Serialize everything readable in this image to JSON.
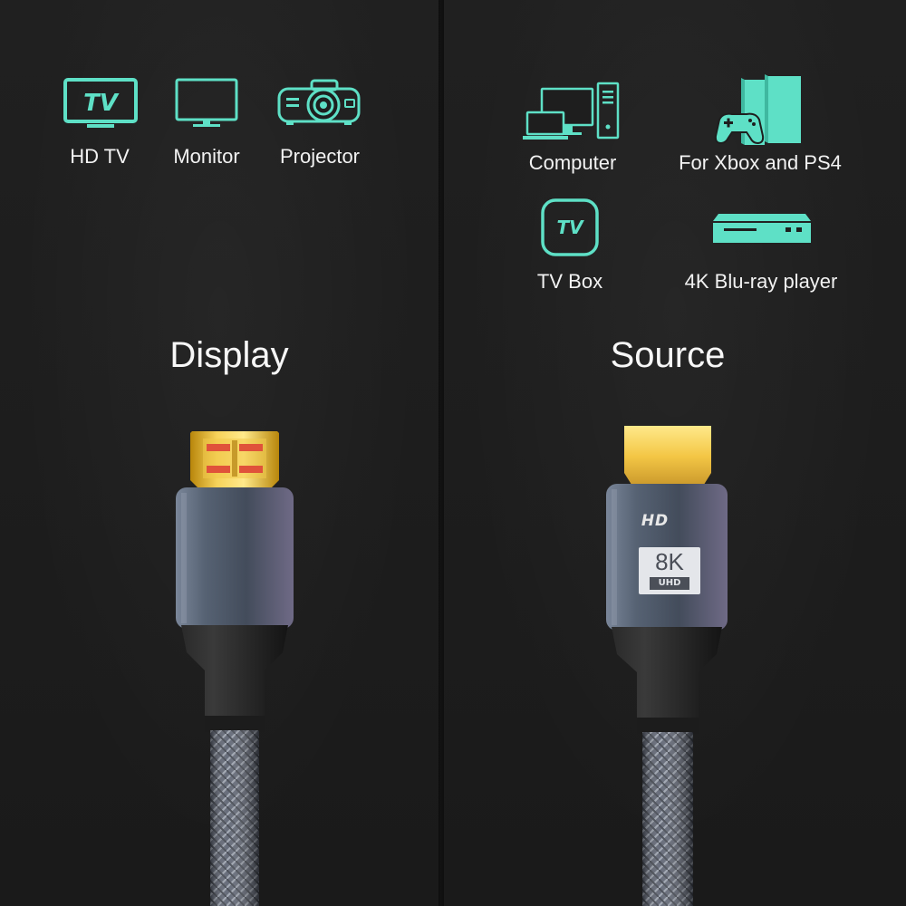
{
  "accent_color": "#5ee0c6",
  "display": {
    "heading": "Display",
    "devices": [
      {
        "label": "HD TV",
        "icon": "tv-icon",
        "icon_text": "TV"
      },
      {
        "label": "Monitor",
        "icon": "monitor-icon"
      },
      {
        "label": "Projector",
        "icon": "projector-icon"
      }
    ]
  },
  "source": {
    "heading": "Source",
    "devices": [
      {
        "label": "Computer",
        "icon": "computer-icon"
      },
      {
        "label": "For Xbox and PS4",
        "icon": "game-console-icon"
      },
      {
        "label": "TV Box",
        "icon": "tv-box-icon",
        "icon_text": "TV"
      },
      {
        "label": "4K Blu-ray player",
        "icon": "blu-ray-player-icon"
      }
    ]
  },
  "connector": {
    "brand": "HD",
    "badge_main": "8K",
    "badge_sub": "UHD"
  }
}
